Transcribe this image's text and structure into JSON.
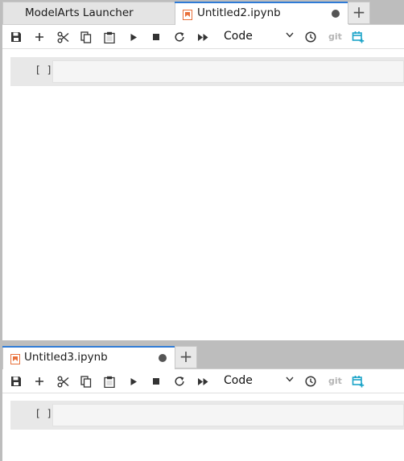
{
  "top_pane": {
    "tabs": [
      {
        "label": "ModelArts Launcher",
        "active": false
      },
      {
        "label": "Untitled2.ipynb",
        "active": true,
        "unsaved": true
      }
    ],
    "add_tab": "+",
    "toolbar": {
      "cell_type": "Code",
      "git_label": "git"
    },
    "cell": {
      "prompt": "[ ]",
      "source": ""
    }
  },
  "bottom_pane": {
    "tabs": [
      {
        "label": "Untitled3.ipynb",
        "active": true,
        "unsaved": true
      }
    ],
    "add_tab": "+",
    "toolbar": {
      "cell_type": "Code",
      "git_label": "git"
    },
    "cell": {
      "prompt": "[ ]",
      "source": ""
    }
  },
  "icons": {
    "toolbar": [
      "save-icon",
      "add-cell-icon",
      "cut-icon",
      "copy-icon",
      "paste-icon",
      "run-icon",
      "stop-icon",
      "restart-icon",
      "run-all-icon",
      "clock-icon",
      "git-icon",
      "calendar-add-icon"
    ],
    "notebook_tab": "notebook-icon"
  },
  "colors": {
    "notebook_icon": "#e8703a",
    "calendar_icon": "#1aa3c8",
    "active_tab_indicator": "#2f7bd6",
    "cell_background": "#e8e8e8"
  }
}
